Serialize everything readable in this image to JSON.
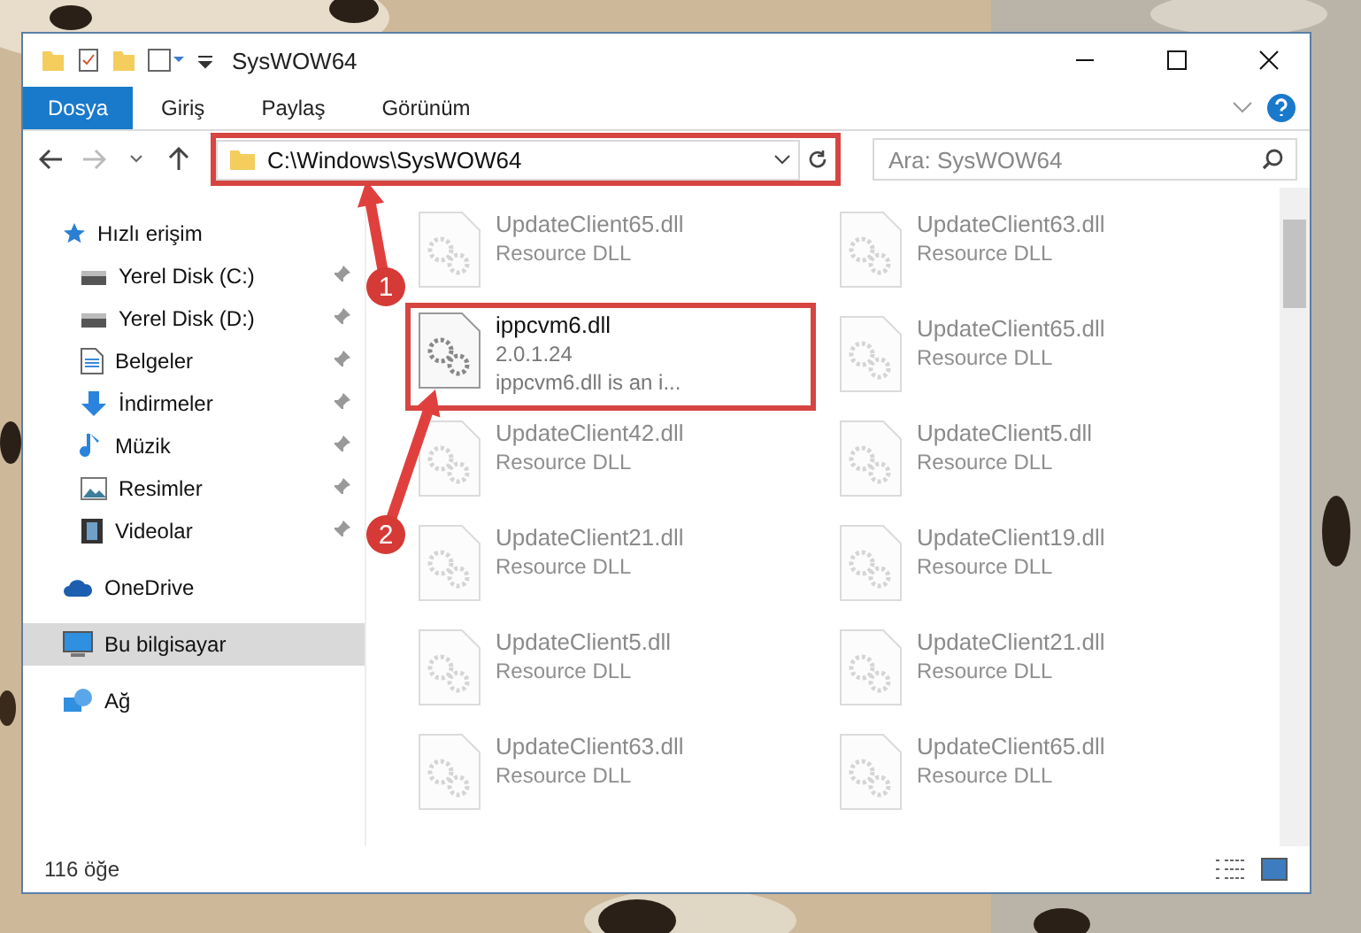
{
  "window": {
    "title": "SysWOW64"
  },
  "ribbon": {
    "tabs": [
      {
        "label": "Dosya",
        "kind": "file"
      },
      {
        "label": "Giriş",
        "kind": "tab"
      },
      {
        "label": "Paylaş",
        "kind": "tab"
      },
      {
        "label": "Görünüm",
        "kind": "tab"
      }
    ]
  },
  "address": {
    "path": "C:\\Windows\\SysWOW64"
  },
  "search": {
    "placeholder": "Ara: SysWOW64"
  },
  "sidebar": {
    "items": [
      {
        "label": "Hızlı erişim",
        "kind": "star",
        "selected": false,
        "children": [
          {
            "label": "Yerel Disk (C:)",
            "kind": "disk",
            "pinned": true,
            "selected": false
          },
          {
            "label": "Yerel Disk (D:)",
            "kind": "disk",
            "pinned": true,
            "selected": false
          },
          {
            "label": "Belgeler",
            "kind": "docs",
            "pinned": true,
            "selected": false
          },
          {
            "label": "İndirmeler",
            "kind": "download",
            "pinned": true,
            "selected": false
          },
          {
            "label": "Müzik",
            "kind": "music",
            "pinned": true,
            "selected": false
          },
          {
            "label": "Resimler",
            "kind": "pictures",
            "pinned": true,
            "selected": false
          },
          {
            "label": "Videolar",
            "kind": "videos",
            "pinned": true,
            "selected": false
          }
        ]
      },
      {
        "label": "OneDrive",
        "kind": "cloud",
        "selected": false
      },
      {
        "label": "Bu bilgisayar",
        "kind": "pc",
        "selected": true
      },
      {
        "label": "Ağ",
        "kind": "network",
        "selected": false
      }
    ]
  },
  "files": [
    {
      "name": "UpdateClient65.dll",
      "lines": [
        "Resource DLL"
      ],
      "faded": true,
      "highlighted": false
    },
    {
      "name": "UpdateClient63.dll",
      "lines": [
        "Resource DLL"
      ],
      "faded": true,
      "highlighted": false
    },
    {
      "name": "ippcvm6.dll",
      "lines": [
        "2.0.1.24",
        "ippcvm6.dll is an i..."
      ],
      "faded": false,
      "highlighted": true
    },
    {
      "name": "UpdateClient65.dll",
      "lines": [
        "Resource DLL"
      ],
      "faded": true,
      "highlighted": false
    },
    {
      "name": "UpdateClient42.dll",
      "lines": [
        "Resource DLL"
      ],
      "faded": true,
      "highlighted": false
    },
    {
      "name": "UpdateClient5.dll",
      "lines": [
        "Resource DLL"
      ],
      "faded": true,
      "highlighted": false
    },
    {
      "name": "UpdateClient21.dll",
      "lines": [
        "Resource DLL"
      ],
      "faded": true,
      "highlighted": false
    },
    {
      "name": "UpdateClient19.dll",
      "lines": [
        "Resource DLL"
      ],
      "faded": true,
      "highlighted": false
    },
    {
      "name": "UpdateClient5.dll",
      "lines": [
        "Resource DLL"
      ],
      "faded": true,
      "highlighted": false
    },
    {
      "name": "UpdateClient21.dll",
      "lines": [
        "Resource DLL"
      ],
      "faded": true,
      "highlighted": false
    },
    {
      "name": "UpdateClient63.dll",
      "lines": [
        "Resource DLL"
      ],
      "faded": true,
      "highlighted": false
    },
    {
      "name": "UpdateClient65.dll",
      "lines": [
        "Resource DLL"
      ],
      "faded": true,
      "highlighted": false
    }
  ],
  "status_bar": {
    "count": "116 öğe"
  },
  "annotations": [
    {
      "number": "1"
    },
    {
      "number": "2"
    }
  ]
}
